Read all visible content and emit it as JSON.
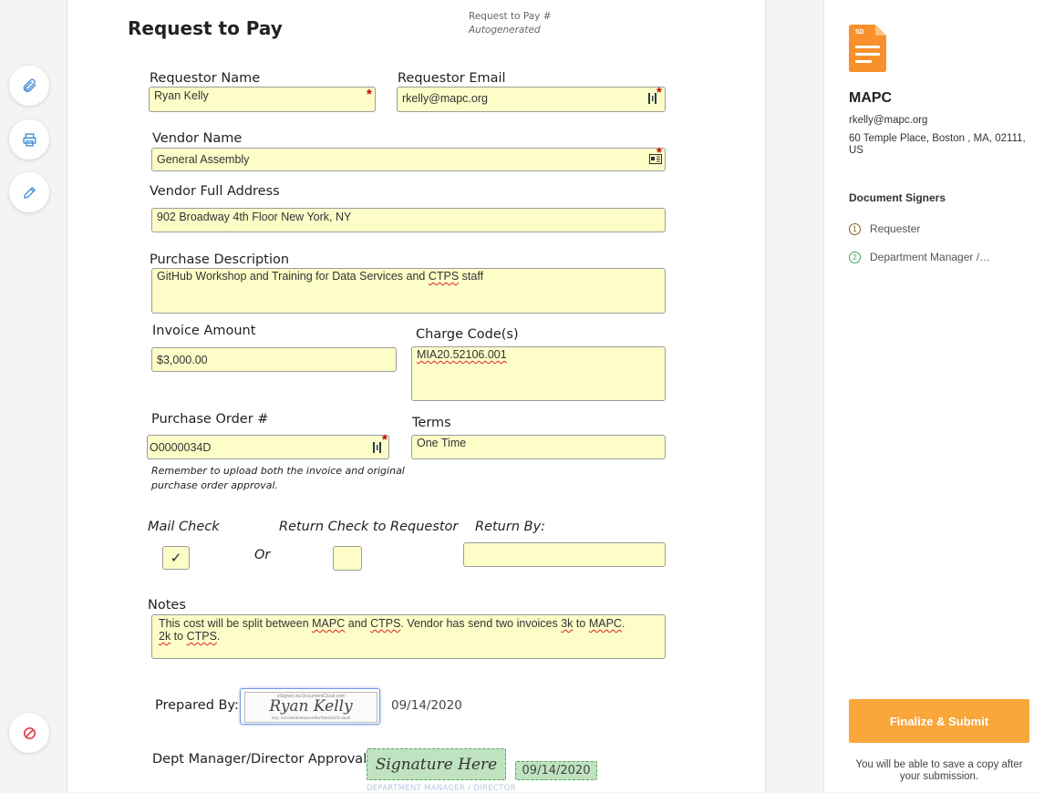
{
  "rail": {
    "attach_icon": "paperclip-icon",
    "print_icon": "printer-icon",
    "edit_icon": "pencil-icon",
    "decline_icon": "cancel-icon"
  },
  "form": {
    "title": "Request to Pay",
    "number_label": "Request to Pay #",
    "number_value": "Autogenerated",
    "requestor_name_label": "Requestor Name",
    "requestor_name_value": "Ryan Kelly",
    "requestor_email_label": "Requestor Email",
    "requestor_email_value": "rkelly@mapc.org",
    "vendor_name_label": "Vendor Name",
    "vendor_name_value": "General Assembly",
    "vendor_address_label": "Vendor Full Address",
    "vendor_address_value": "902 Broadway 4th Floor New York, NY",
    "purchase_description_label": "Purchase Description",
    "purchase_description_pre": "GitHub Workshop and Training for Data Services and ",
    "purchase_description_mark": "CTPS",
    "purchase_description_post": " staff",
    "invoice_amount_label": "Invoice Amount",
    "invoice_amount_value": "$3,000.00",
    "charge_codes_label": "Charge Code(s)",
    "charge_codes_value": "MIA20.52106.001",
    "po_label": "Purchase Order #",
    "po_value": "O0000034D",
    "po_note_1": "Remember to upload both the invoice and original",
    "po_note_2": "purchase order approval.",
    "terms_label": "Terms",
    "terms_value": "One Time",
    "mail_check_label": "Mail Check",
    "mail_check_mark": "✓",
    "or_label": "Or",
    "return_check_label": "Return Check to Requestor",
    "return_by_label": "Return By:",
    "return_by_value": "",
    "notes_label": "Notes",
    "notes": {
      "t1": "This cost will be split between ",
      "m1": "MAPC",
      "t2": " and ",
      "m2": "CTPS",
      "t3": ". Vendor has send two invoices ",
      "m3": "3k",
      "t4": " to ",
      "m4": "MAPC",
      "t5": ".",
      "m5": "2k",
      "t6": " to ",
      "m6": "CTPS",
      "t7": "."
    },
    "prepared_by_label": "Prepared By:",
    "prepared_signature_top": "eSigned via DocumentCloud.com",
    "prepared_signature_name": "Ryan Kelly",
    "prepared_signature_bottom": "Key: 32cc9ebb29aa4c9f8a7b6e0d1f2c3a4b",
    "prepared_date": "09/14/2020",
    "approval_label": "Dept Manager/Director Approval:",
    "approval_signature_placeholder": "Signature Here",
    "approval_date": "09/14/2020",
    "approval_caption": "DEPARTMENT MANAGER / DIRECTOR"
  },
  "sender": {
    "file_badge": "SD",
    "name": "MAPC",
    "email": "rkelly@mapc.org",
    "address_line1": "60 Temple Place, Boston , MA, 02111,",
    "address_line2": "US"
  },
  "signers": {
    "heading": "Document Signers",
    "items": [
      {
        "num": "1",
        "label": "Requester"
      },
      {
        "num": "2",
        "label": "Department Manager /…"
      }
    ]
  },
  "actions": {
    "finalize_label": "Finalize & Submit",
    "finalize_note": "You will be able to save a copy after your submission."
  },
  "colors": {
    "field_bg": "#fdfdc8",
    "accent_orange": "#f9a63a",
    "signer1": "#8a5a14",
    "signer2": "#3aa757",
    "link_blue": "#4a90d9"
  }
}
